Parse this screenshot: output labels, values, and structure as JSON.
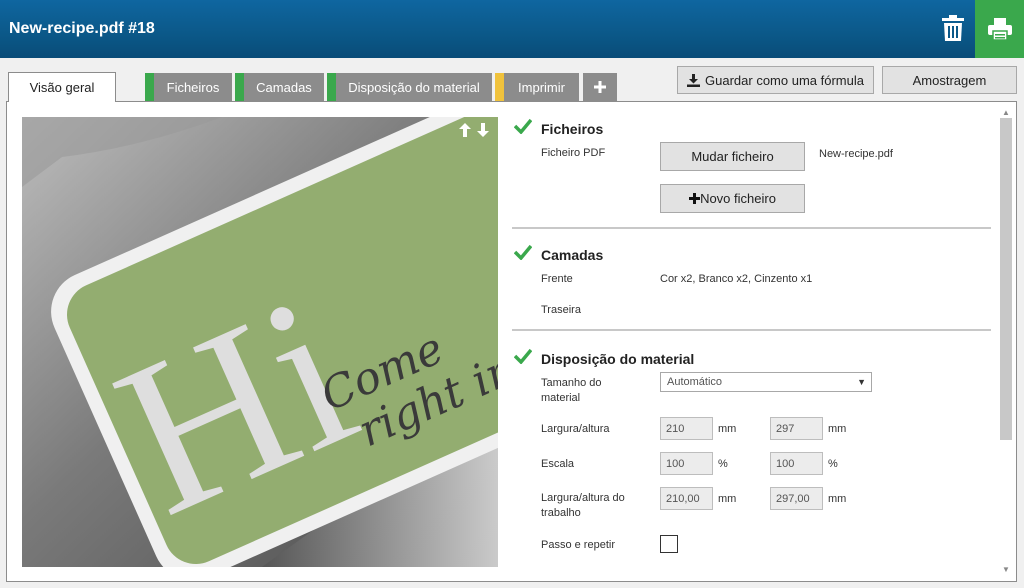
{
  "header": {
    "title": "New-recipe.pdf #18",
    "delete_icon": "trash-icon",
    "print_icon": "printer-icon",
    "accent": "#3aa84c"
  },
  "tabs": [
    {
      "label": "Visão geral",
      "active": true
    },
    {
      "label": "Ficheiros",
      "stripe": "#3aa84c"
    },
    {
      "label": "Camadas",
      "stripe": "#3aa84c"
    },
    {
      "label": "Disposição do material",
      "stripe": "#3aa84c"
    },
    {
      "label": "Imprimir",
      "stripe": "#f0c23c"
    },
    {
      "label": "+",
      "icon": "plus-icon"
    }
  ],
  "toolbar": {
    "save_formula": "Guardar como uma fórmula",
    "save_icon": "download-icon",
    "sampling": "Amostragem"
  },
  "preview": {
    "big_text": "Hi",
    "script_line1": "Come",
    "script_line2": "right in"
  },
  "sections": {
    "files": {
      "title": "Ficheiros",
      "pdf_label": "Ficheiro PDF",
      "change_button": "Mudar ficheiro",
      "filename": "New-recipe.pdf",
      "new_button": "Novo ficheiro"
    },
    "layers": {
      "title": "Camadas",
      "front_label": "Frente",
      "front_value": "Cor x2, Branco x2, Cinzento x1",
      "back_label": "Traseira"
    },
    "layout": {
      "title": "Disposição do material",
      "size_label": "Tamanho do material",
      "size_value": "Automático",
      "wh_label": "Largura/altura",
      "width": "210",
      "height": "297",
      "unit_mm": "mm",
      "scale_label": "Escala",
      "scale_x": "100",
      "scale_y": "100",
      "unit_pct": "%",
      "job_label": "Largura/altura do trabalho",
      "job_width": "210,00",
      "job_height": "297,00",
      "step_label": "Passo e repetir"
    }
  }
}
